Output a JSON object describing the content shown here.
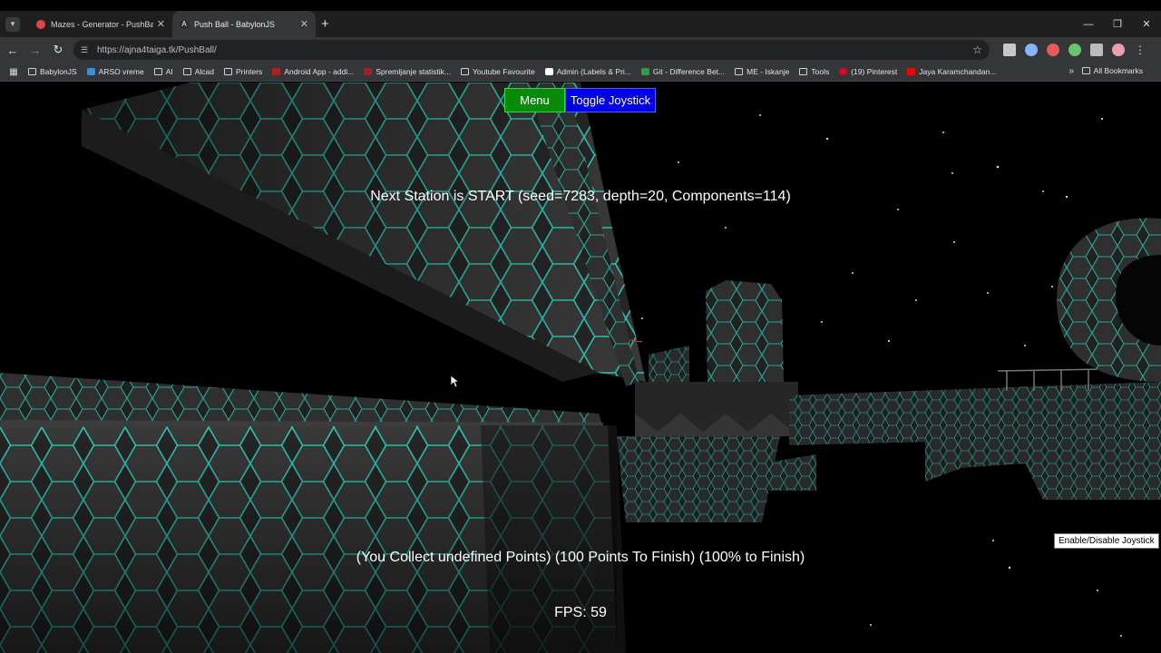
{
  "browser": {
    "tabs": [
      {
        "title": "Mazes - Generator - PushBall -",
        "active": false,
        "favicon_color": "#e04545"
      },
      {
        "title": "Push Ball - BabylonJS",
        "active": true,
        "favicon_color": "#2b2b2b"
      }
    ],
    "url": "https://ajna4taiga.tk/PushBall/",
    "bookmarks": [
      {
        "label": "BabylonJS",
        "icon": "folder-icon"
      },
      {
        "label": "ARSO vreme",
        "icon": "arso-icon"
      },
      {
        "label": "AI",
        "icon": "folder-icon"
      },
      {
        "label": "Alcad",
        "icon": "folder-icon"
      },
      {
        "label": "Printers",
        "icon": "folder-icon"
      },
      {
        "label": "Android App - addi...",
        "icon": "app-icon"
      },
      {
        "label": "Spremljanje statistik...",
        "icon": "app-icon"
      },
      {
        "label": "Youtube Favourite",
        "icon": "folder-icon"
      },
      {
        "label": "Admin (Labels & Pri...",
        "icon": "facebook-icon"
      },
      {
        "label": "Git - Difference Bet...",
        "icon": "git-icon"
      },
      {
        "label": "ME - Iskanje",
        "icon": "folder-icon"
      },
      {
        "label": "Tools",
        "icon": "folder-icon"
      },
      {
        "label": "(19) Pinterest",
        "icon": "pinterest-icon"
      },
      {
        "label": "Jaya Karamchandan...",
        "icon": "youtube-icon"
      }
    ],
    "all_bookmarks": "All Bookmarks"
  },
  "game": {
    "menu_button": "Menu",
    "joystick_button": "Toggle Joystick",
    "station_text": "Next Station is START (seed=7283, depth=20, Components=114)",
    "points_text": "(You Collect undefined Points) (100 Points To Finish) (100% to Finish)",
    "fps_text": "FPS: 59",
    "tooltip": "Enable/Disable Joystick"
  },
  "colors": {
    "menu_green": "#0a8a0a",
    "joystick_blue": "#0000e8",
    "hex_glow": "#33e0d0",
    "panel_dark": "#2a2a2a"
  }
}
